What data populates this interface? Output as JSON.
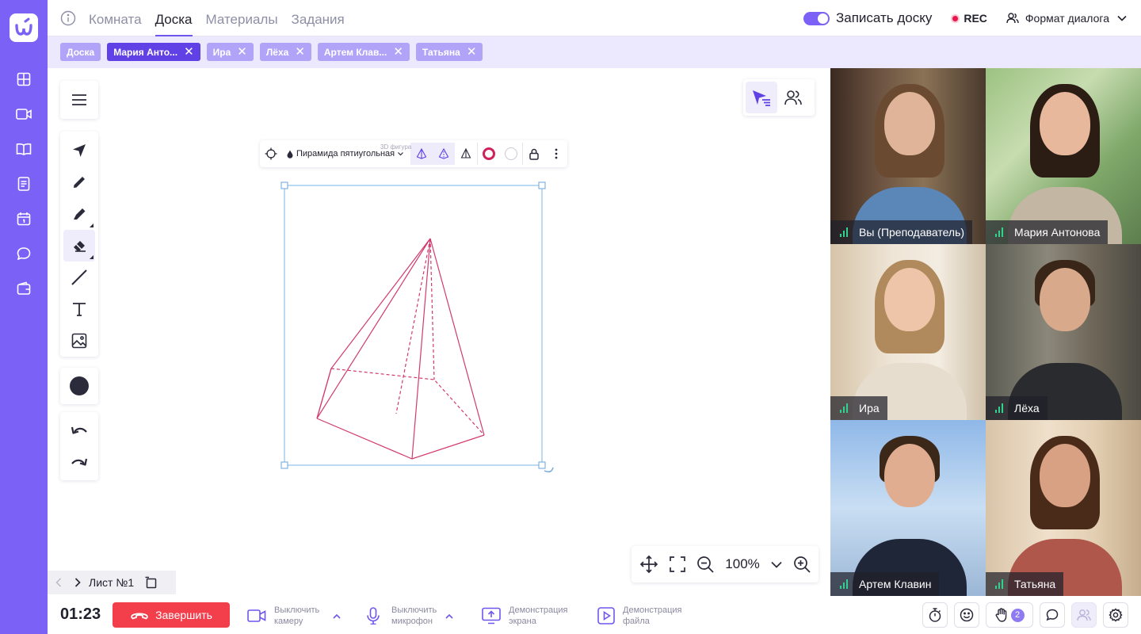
{
  "sidebar": {
    "logo_icon": "logo-icon",
    "icons": [
      "dashboard-icon",
      "video-icon",
      "book-icon",
      "document-icon",
      "calendar-icon",
      "chat-icon",
      "wallet-icon"
    ]
  },
  "topbar": {
    "tabs": [
      {
        "label": "Комната",
        "active": false
      },
      {
        "label": "Доска",
        "active": true
      },
      {
        "label": "Материалы",
        "active": false
      },
      {
        "label": "Задания",
        "active": false
      }
    ],
    "record_label": "Записать доску",
    "record_enabled": true,
    "rec_label": "REC",
    "format_label": "Формат диалога"
  },
  "chips": [
    {
      "label": "Доска",
      "selected": false,
      "closable": false
    },
    {
      "label": "Мария Анто...",
      "selected": true,
      "closable": true
    },
    {
      "label": "Ира",
      "selected": false,
      "closable": true
    },
    {
      "label": "Лёха",
      "selected": false,
      "closable": true
    },
    {
      "label": "Артем Клав...",
      "selected": false,
      "closable": true
    },
    {
      "label": "Татьяна",
      "selected": false,
      "closable": true
    }
  ],
  "shape_toolbar": {
    "type_label": "3D фигура",
    "value": "Пирамида пятиугольная",
    "stroke_color": "#d0215a",
    "fill_color": "#ffffff"
  },
  "drawing": {
    "shape": "pentagonal-pyramid",
    "color": "#d23a6e"
  },
  "zoom": {
    "value": "100%"
  },
  "pages": {
    "label": "Лист №1"
  },
  "color_swatch": "#2b2b3c",
  "participants": [
    {
      "name": "Вы (Преподаватель)"
    },
    {
      "name": "Мария Антонова"
    },
    {
      "name": "Ира"
    },
    {
      "name": "Лёха"
    },
    {
      "name": "Артем Клавин"
    },
    {
      "name": "Татьяна"
    }
  ],
  "bottombar": {
    "timer": "01:23",
    "end_label": "Завершить",
    "camera_label_1": "Выключить",
    "camera_label_2": "камеру",
    "mic_label_1": "Выключить",
    "mic_label_2": "микрофон",
    "screen_label_1": "Демонстрация",
    "screen_label_2": "экрана",
    "file_label_1": "Демонстрация",
    "file_label_2": "файла",
    "hand_count": "2"
  }
}
